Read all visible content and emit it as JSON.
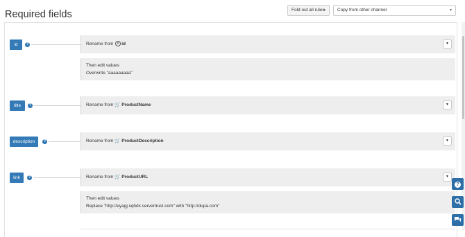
{
  "page": {
    "title": "Required fields"
  },
  "toolbar": {
    "fold_label": "Fold out all rules",
    "copy_value": "Copy from other channel"
  },
  "icons": {
    "help": "?",
    "dropdown_caret": "▼",
    "cart": "🛒",
    "pin": "P",
    "chat": "💬",
    "search": "🔍"
  },
  "fields": [
    {
      "name": "id",
      "rename_prefix": "Rename from",
      "source": "id",
      "source_icon": "pin-icon",
      "edit_title": "Then edit values",
      "edit_text": "Overwrite \"aaaaaaaaa\""
    },
    {
      "name": "title",
      "rename_prefix": "Rename from",
      "source": "ProductName",
      "source_icon": "cart-icon"
    },
    {
      "name": "description",
      "rename_prefix": "Rename from",
      "source": "ProductDescription",
      "source_icon": "cart-icon"
    },
    {
      "name": "link",
      "rename_prefix": "Rename from",
      "source": "ProductURL",
      "source_icon": "cart-icon",
      "edit_title": "Then edit values",
      "edit_text": "Replace \"http://eyagj.sqhdx.servertrust.com\" with \"http://dupa.com\""
    }
  ],
  "colors": {
    "accent": "#337ab7",
    "panel_bg": "#eeeeee"
  }
}
